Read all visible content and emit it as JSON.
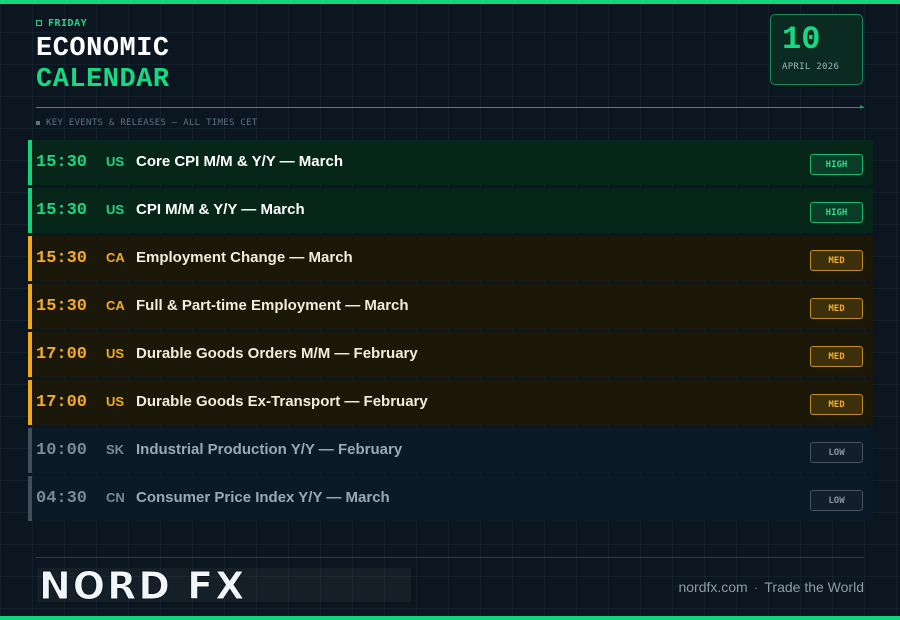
{
  "header": {
    "day": "FRIDAY",
    "title_line1": "ECONOMIC",
    "title_line2": "CALENDAR",
    "date_day": "10",
    "date_month_year": "APRIL 2026",
    "subtitle": "KEY EVENTS & RELEASES — ALL TIMES CET"
  },
  "events": [
    {
      "time": "15:30",
      "country": "US",
      "title": "Core CPI M/M & Y/Y — March",
      "impact": "HIGH"
    },
    {
      "time": "15:30",
      "country": "US",
      "title": "CPI M/M & Y/Y — March",
      "impact": "HIGH"
    },
    {
      "time": "15:30",
      "country": "CA",
      "title": "Employment Change — March",
      "impact": "MED"
    },
    {
      "time": "15:30",
      "country": "CA",
      "title": "Full & Part-time Employment — March",
      "impact": "MED"
    },
    {
      "time": "17:00",
      "country": "US",
      "title": "Durable Goods Orders M/M — February",
      "impact": "MED"
    },
    {
      "time": "17:00",
      "country": "US",
      "title": "Durable Goods Ex-Transport — February",
      "impact": "MED"
    },
    {
      "time": "10:00",
      "country": "SK",
      "title": "Industrial Production Y/Y — February",
      "impact": "LOW"
    },
    {
      "time": "04:30",
      "country": "CN",
      "title": "Consumer Price Index Y/Y — March",
      "impact": "LOW"
    }
  ],
  "footer": {
    "logo_text": "NORD FX",
    "site": "nordfx.com",
    "separator": "·",
    "tagline": "Trade the World"
  },
  "colors": {
    "accent_green": "#19d883",
    "medium_amber": "#f4ac22",
    "low_gray": "#7d8b95",
    "background": "#0b1620"
  }
}
